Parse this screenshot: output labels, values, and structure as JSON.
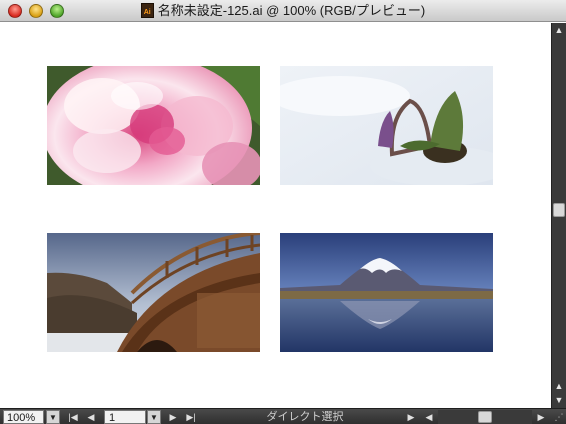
{
  "window": {
    "title": "名称未設定-125.ai @ 100% (RGB/プレビュー)",
    "file_icon_label": "Ai",
    "file_icon_color": "#ff9c1a"
  },
  "title_bar": {
    "close_color": "#e0433a",
    "minimize_color": "#f0b21d",
    "zoom_color": "#5bb63a"
  },
  "canvas": {
    "background": "#ffffff",
    "artworks": [
      {
        "name": "peony-flower-photo",
        "subject": "pink peony flower"
      },
      {
        "name": "snow-flower-photo",
        "subject": "purple dogtooth violet sprouting through snow"
      },
      {
        "name": "wooden-bridge-photo",
        "subject": "arched wooden bridge under blue sky"
      },
      {
        "name": "mount-fuji-photo",
        "subject": "snow-capped Mount Fuji reflected in lake"
      }
    ]
  },
  "status_bar": {
    "zoom_value": "100%",
    "page_value": "1",
    "tool_label": "ダイレクト選択",
    "first_icon": "first-page-icon",
    "prev_icon": "prev-page-icon",
    "next_icon": "next-page-icon",
    "last_icon": "last-page-icon"
  },
  "scrollbars": {
    "vertical_position": 0.47,
    "horizontal_position": 0.47
  }
}
